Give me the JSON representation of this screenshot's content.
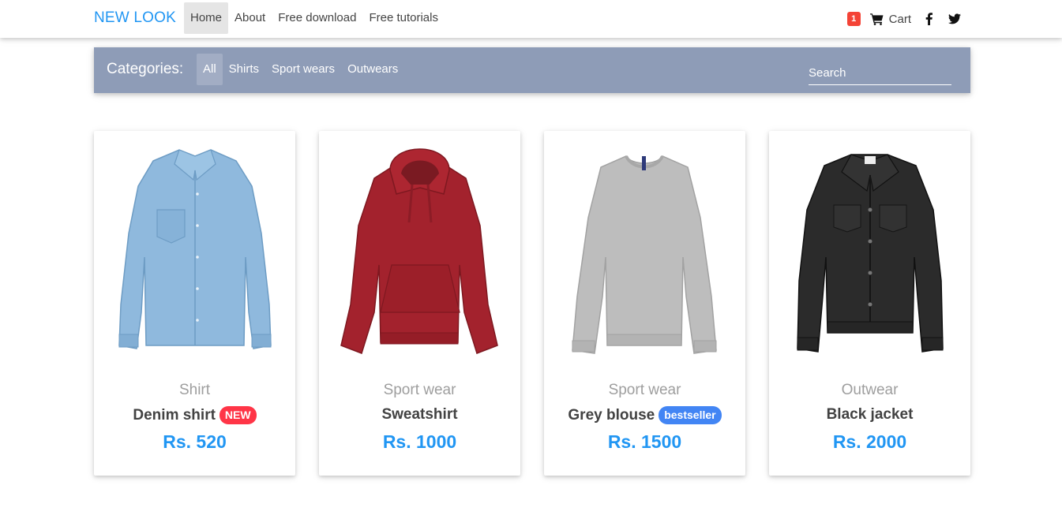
{
  "navbar": {
    "brand": "NEW LOOK",
    "links": [
      "Home",
      "About",
      "Free download",
      "Free tutorials"
    ],
    "active_link": "Home",
    "cart_count": "1",
    "cart_label": "Cart",
    "brand_color": "#2196f3",
    "social_icons": [
      "facebook-icon",
      "twitter-icon"
    ]
  },
  "categories": {
    "title": "Categories:",
    "items": [
      "All",
      "Shirts",
      "Sport wears",
      "Outwears"
    ],
    "active_item": "All",
    "search_placeholder": "Search",
    "bar_color": "#8e9cb7"
  },
  "products": [
    {
      "category": "Shirt",
      "name": "Denim shirt",
      "badge": "NEW",
      "price": "Rs. 520",
      "image": "denim-shirt"
    },
    {
      "category": "Sport wear",
      "name": "Sweatshirt",
      "badge": "",
      "price": "Rs. 1000",
      "image": "red-hoodie"
    },
    {
      "category": "Sport wear",
      "name": "Grey blouse",
      "badge": "bestseller",
      "price": "Rs. 1500",
      "image": "grey-sweater"
    },
    {
      "category": "Outwear",
      "name": "Black jacket",
      "badge": "",
      "price": "Rs. 2000",
      "image": "black-denim-jacket"
    }
  ],
  "colors": {
    "price": "#2196f3",
    "badge_new": "#ff3547",
    "badge_bestseller": "#4285f4",
    "cart_badge": "#f44336"
  }
}
